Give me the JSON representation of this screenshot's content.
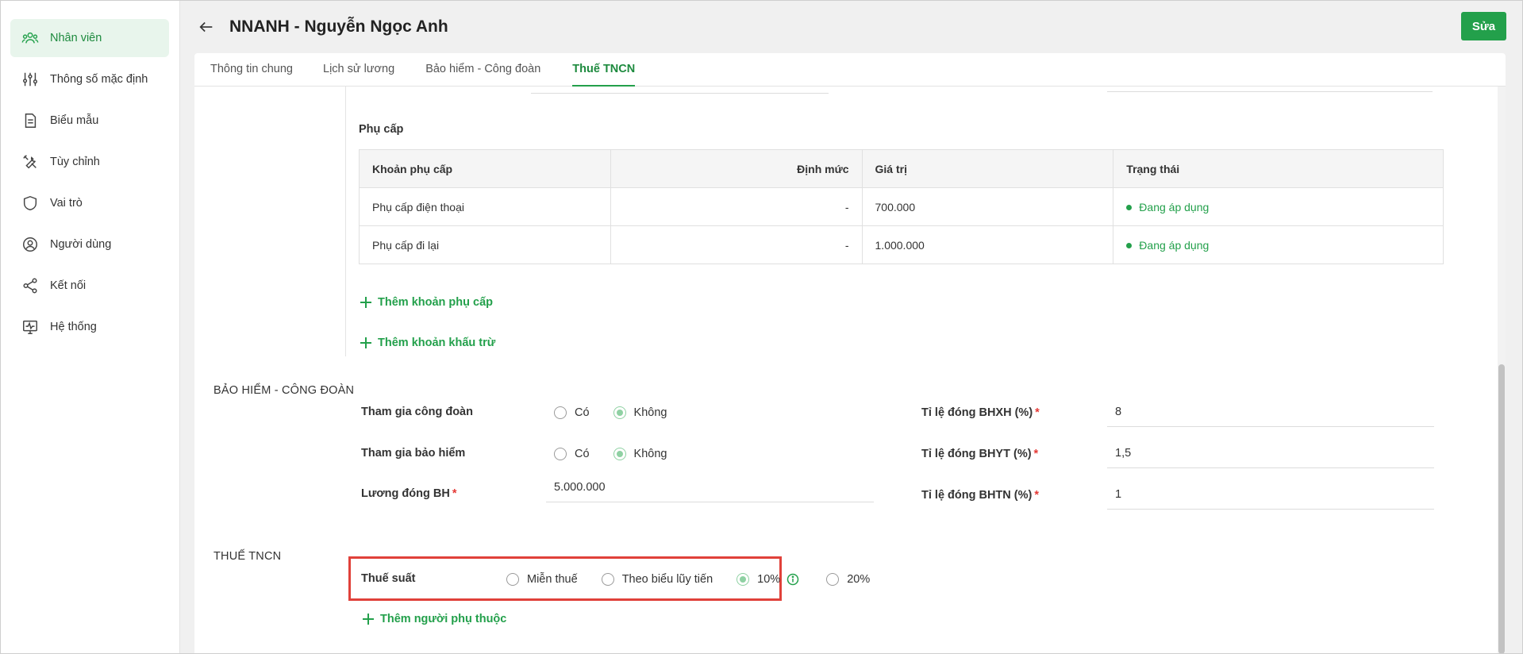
{
  "sidebar": {
    "items": [
      {
        "label": "Nhân viên",
        "icon": "employees-icon",
        "active": true
      },
      {
        "label": "Thông số mặc định",
        "icon": "sliders-icon",
        "active": false
      },
      {
        "label": "Biểu mẫu",
        "icon": "document-icon",
        "active": false
      },
      {
        "label": "Tùy chỉnh",
        "icon": "tools-icon",
        "active": false
      },
      {
        "label": "Vai trò",
        "icon": "shield-icon",
        "active": false
      },
      {
        "label": "Người dùng",
        "icon": "user-circle-icon",
        "active": false
      },
      {
        "label": "Kết nối",
        "icon": "share-icon",
        "active": false
      },
      {
        "label": "Hệ thống",
        "icon": "monitor-pulse-icon",
        "active": false
      }
    ]
  },
  "header": {
    "title": "NNANH - Nguyễn Ngọc Anh",
    "edit_label": "Sửa"
  },
  "tabs": [
    {
      "label": "Thông tin chung",
      "active": false
    },
    {
      "label": "Lịch sử lương",
      "active": false
    },
    {
      "label": "Bảo hiểm - Công đoàn",
      "active": false
    },
    {
      "label": "Thuế TNCN",
      "active": true
    }
  ],
  "allowance": {
    "title": "Phụ cấp",
    "columns": [
      "Khoản phụ cấp",
      "Định mức",
      "Giá trị",
      "Trạng thái"
    ],
    "rows": [
      {
        "name": "Phụ cấp điện thoại",
        "norm": "-",
        "value": "700.000",
        "status": "Đang áp dụng"
      },
      {
        "name": "Phụ cấp đi lại",
        "norm": "-",
        "value": "1.000.000",
        "status": "Đang áp dụng"
      }
    ],
    "add_allowance_label": "Thêm khoản phụ cấp",
    "add_deduction_label": "Thêm khoản khấu trừ"
  },
  "insurance": {
    "section_title": "BẢO HIỂM - CÔNG ĐOÀN",
    "union_label": "Tham gia công đoàn",
    "insurance_label": "Tham gia bảo hiểm",
    "option_yes": "Có",
    "option_no": "Không",
    "union_value": "Không",
    "insurance_value": "Không",
    "salary_label": "Lương đóng BH",
    "salary_value": "5.000.000",
    "bhxh_label": "Tỉ lệ đóng BHXH (%)",
    "bhxh_value": "8",
    "bhyt_label": "Tỉ lệ đóng BHYT (%)",
    "bhyt_value": "1,5",
    "bhtn_label": "Tỉ lệ đóng BHTN (%)",
    "bhtn_value": "1"
  },
  "tax": {
    "section_title": "THUẾ TNCN",
    "rate_label": "Thuế suất",
    "options": [
      "Miễn thuế",
      "Theo biểu lũy tiến",
      "10%",
      "20%"
    ],
    "selected": "10%",
    "add_dependent_label": "Thêm người phụ thuộc"
  },
  "colors": {
    "accent": "#23a04b",
    "highlight_border": "#e0413a",
    "required": "#e53935"
  }
}
